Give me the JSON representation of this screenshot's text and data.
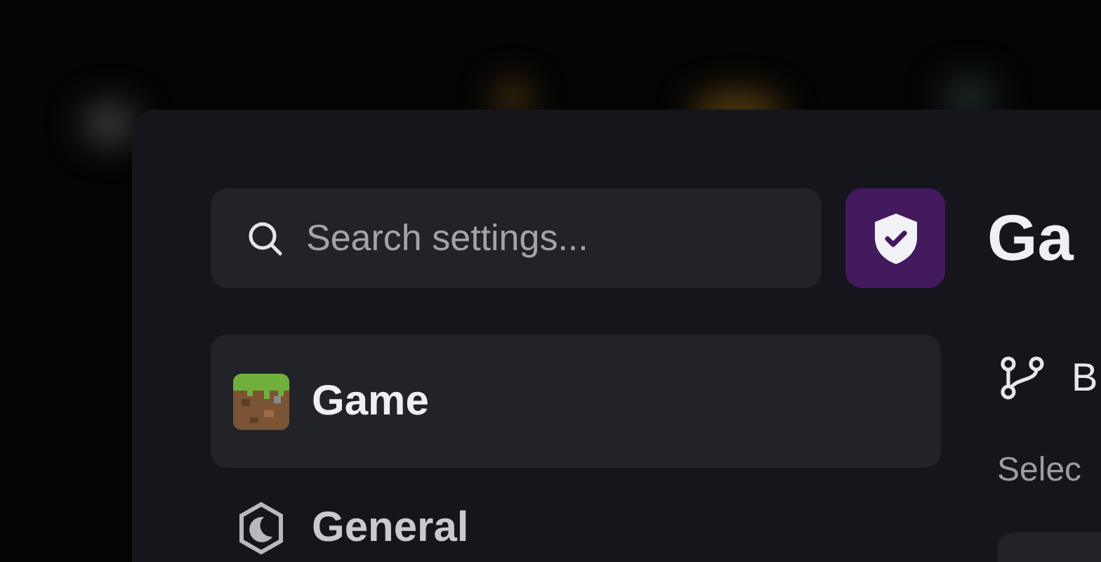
{
  "search": {
    "placeholder": "Search settings..."
  },
  "sidebar": {
    "items": [
      {
        "label": "Game",
        "kind": "grass",
        "selected": true
      },
      {
        "label": "General",
        "kind": "moon",
        "selected": false
      }
    ]
  },
  "content": {
    "title": "Ga",
    "section": {
      "label": "B"
    },
    "hint": "Selec"
  }
}
